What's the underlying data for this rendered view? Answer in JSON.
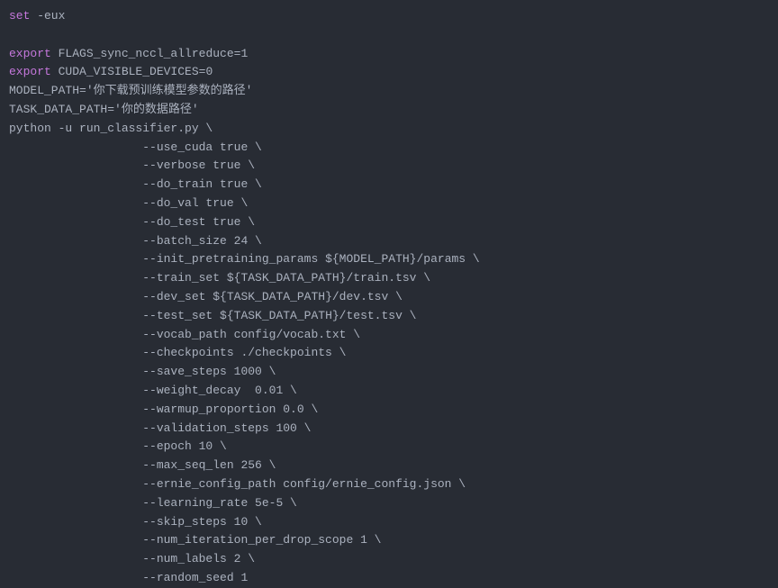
{
  "lines": [
    {
      "segments": [
        {
          "class": "keyword",
          "text": "set"
        },
        {
          "class": "command",
          "text": " -eux"
        }
      ]
    },
    {
      "segments": [
        {
          "class": "command",
          "text": ""
        }
      ]
    },
    {
      "segments": [
        {
          "class": "keyword",
          "text": "export"
        },
        {
          "class": "command",
          "text": " FLAGS_sync_nccl_allreduce=1"
        }
      ]
    },
    {
      "segments": [
        {
          "class": "keyword",
          "text": "export"
        },
        {
          "class": "command",
          "text": " CUDA_VISIBLE_DEVICES=0"
        }
      ]
    },
    {
      "segments": [
        {
          "class": "var-assign",
          "text": "MODEL_PATH='你下载预训练模型参数的路径'"
        }
      ]
    },
    {
      "segments": [
        {
          "class": "var-assign",
          "text": "TASK_DATA_PATH='你的数据路径'"
        }
      ]
    },
    {
      "segments": [
        {
          "class": "command",
          "text": "python -u run_classifier.py \\"
        }
      ]
    },
    {
      "segments": [
        {
          "class": "flag",
          "text": "                   --use_cuda true \\"
        }
      ]
    },
    {
      "segments": [
        {
          "class": "flag",
          "text": "                   --verbose true \\"
        }
      ]
    },
    {
      "segments": [
        {
          "class": "flag",
          "text": "                   --do_train true \\"
        }
      ]
    },
    {
      "segments": [
        {
          "class": "flag",
          "text": "                   --do_val true \\"
        }
      ]
    },
    {
      "segments": [
        {
          "class": "flag",
          "text": "                   --do_test true \\"
        }
      ]
    },
    {
      "segments": [
        {
          "class": "flag",
          "text": "                   --batch_size 24 \\"
        }
      ]
    },
    {
      "segments": [
        {
          "class": "flag",
          "text": "                   --init_pretraining_params "
        },
        {
          "class": "path-var",
          "text": "${MODEL_PATH}"
        },
        {
          "class": "flag",
          "text": "/params \\"
        }
      ]
    },
    {
      "segments": [
        {
          "class": "flag",
          "text": "                   --train_set "
        },
        {
          "class": "path-var",
          "text": "${TASK_DATA_PATH}"
        },
        {
          "class": "flag",
          "text": "/train.tsv \\"
        }
      ]
    },
    {
      "segments": [
        {
          "class": "flag",
          "text": "                   --dev_set "
        },
        {
          "class": "path-var",
          "text": "${TASK_DATA_PATH}"
        },
        {
          "class": "flag",
          "text": "/dev.tsv \\"
        }
      ]
    },
    {
      "segments": [
        {
          "class": "flag",
          "text": "                   --test_set "
        },
        {
          "class": "path-var",
          "text": "${TASK_DATA_PATH}"
        },
        {
          "class": "flag",
          "text": "/test.tsv \\"
        }
      ]
    },
    {
      "segments": [
        {
          "class": "flag",
          "text": "                   --vocab_path config/vocab.txt \\"
        }
      ]
    },
    {
      "segments": [
        {
          "class": "flag",
          "text": "                   --checkpoints ./checkpoints \\"
        }
      ]
    },
    {
      "segments": [
        {
          "class": "flag",
          "text": "                   --save_steps 1000 \\"
        }
      ]
    },
    {
      "segments": [
        {
          "class": "flag",
          "text": "                   --weight_decay  0.01 \\"
        }
      ]
    },
    {
      "segments": [
        {
          "class": "flag",
          "text": "                   --warmup_proportion 0.0 \\"
        }
      ]
    },
    {
      "segments": [
        {
          "class": "flag",
          "text": "                   --validation_steps 100 \\"
        }
      ]
    },
    {
      "segments": [
        {
          "class": "flag",
          "text": "                   --epoch 10 \\"
        }
      ]
    },
    {
      "segments": [
        {
          "class": "flag",
          "text": "                   --max_seq_len 256 \\"
        }
      ]
    },
    {
      "segments": [
        {
          "class": "flag",
          "text": "                   --ernie_config_path config/ernie_config.json \\"
        }
      ]
    },
    {
      "segments": [
        {
          "class": "flag",
          "text": "                   --learning_rate 5e-5 \\"
        }
      ]
    },
    {
      "segments": [
        {
          "class": "flag",
          "text": "                   --skip_steps 10 \\"
        }
      ]
    },
    {
      "segments": [
        {
          "class": "flag",
          "text": "                   --num_iteration_per_drop_scope 1 \\"
        }
      ]
    },
    {
      "segments": [
        {
          "class": "flag",
          "text": "                   --num_labels 2 \\"
        }
      ]
    },
    {
      "segments": [
        {
          "class": "flag",
          "text": "                   --random_seed 1"
        }
      ]
    }
  ]
}
